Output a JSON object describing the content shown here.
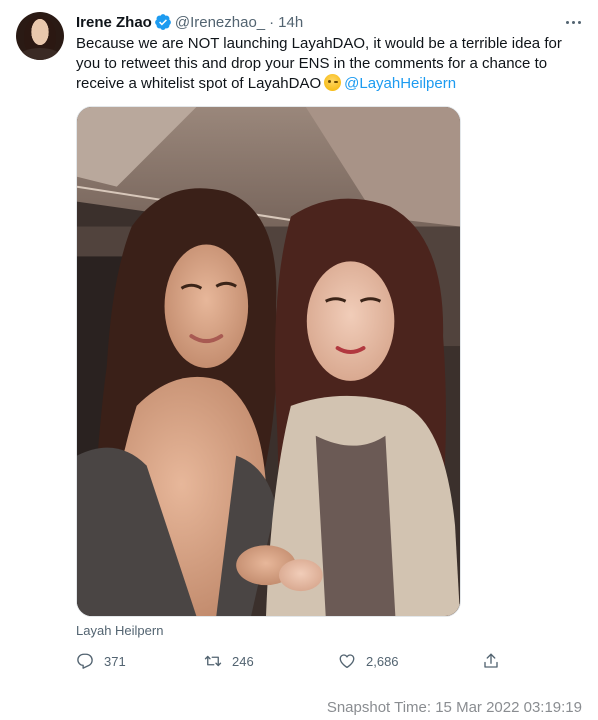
{
  "tweet": {
    "author_name": "Irene Zhao",
    "handle": "@Irenezhao_",
    "separator": "·",
    "time": "14h",
    "text_line1": "Because we are NOT launching LayahDAO, it would be a terrible idea for",
    "text_line2": "you to retweet this and drop your ENS in the comments for a chance to",
    "text_line3": "receive a whitelist spot of LayahDAO",
    "emoji": "winking-face-emoji",
    "mention": "@LayahHeilpern",
    "media_caption": "Layah Heilpern"
  },
  "actions": {
    "reply_count": "371",
    "retweet_count": "246",
    "like_count": "2,686"
  },
  "footer": {
    "snapshot_text": "Snapshot Time:  15 Mar 2022 03:19:19"
  },
  "colors": {
    "accent": "#1d9bf0",
    "secondary_text": "#536471",
    "primary_text": "#0f1419"
  },
  "icons": {
    "verified": "verified-badge-icon",
    "more": "more-options-icon",
    "reply": "reply-icon",
    "retweet": "retweet-icon",
    "like": "heart-icon",
    "share": "share-icon"
  }
}
